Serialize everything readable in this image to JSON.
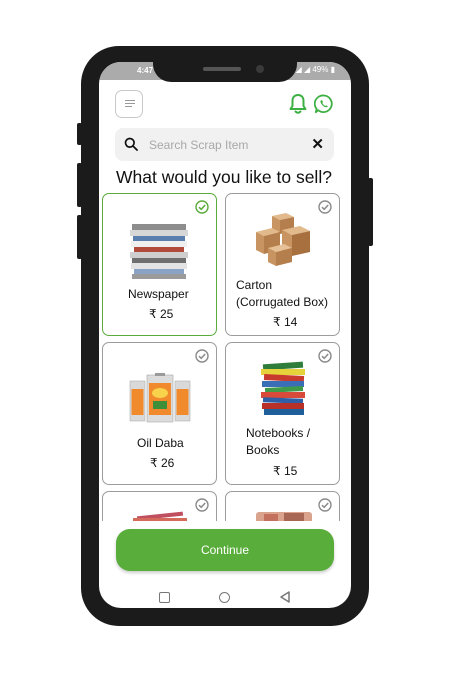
{
  "status_bar": {
    "time": "4:47",
    "icons_text": "◢ ◢ 49% ▮"
  },
  "header": {
    "menu_icon": "menu-icon",
    "notification_icon": "bell-icon",
    "chat_icon": "whatsapp-icon"
  },
  "search": {
    "placeholder": "Search Scrap Item",
    "clear_symbol": "✕"
  },
  "heading": "What would you like to sell?",
  "items": [
    {
      "name": "Newspaper",
      "price": "₹ 25",
      "selected": true
    },
    {
      "name": "Carton (Corrugated Box)",
      "price": "₹ 14",
      "selected": false
    },
    {
      "name": "Oil Daba",
      "price": "₹ 26",
      "selected": false
    },
    {
      "name": "Notebooks / Books",
      "price": "₹ 15",
      "selected": false
    }
  ],
  "continue_label": "Continue",
  "colors": {
    "accent": "#5aab3b",
    "button": "#59ad3b"
  }
}
